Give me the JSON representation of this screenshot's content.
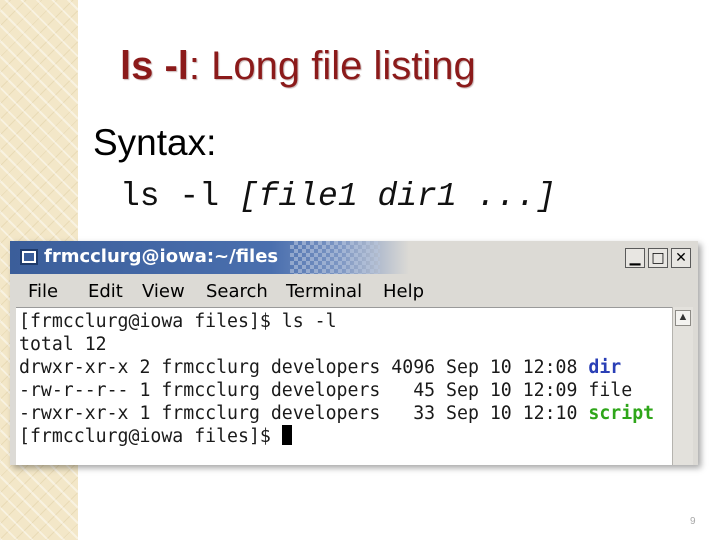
{
  "slide": {
    "title_keyword": "ls -l",
    "title_rest": ": Long file listing",
    "syntax_label": "Syntax:",
    "syntax_cmd": "ls -l ",
    "syntax_args": "[file1 dir1 ...]",
    "page_number": "9"
  },
  "terminal": {
    "window_title": "frmcclurg@iowa:~/files",
    "buttons": {
      "minimize": "▁",
      "maximize": "□",
      "close": "✕"
    },
    "menu": [
      "File",
      "Edit",
      "View",
      "Search",
      "Terminal",
      "Help"
    ],
    "lines": {
      "prompt1": "[frmcclurg@iowa files]$ ls -l",
      "total": "total 12",
      "row1_prefix": "drwxr-xr-x 2 frmcclurg developers 4096 Sep 10 12:08 ",
      "row1_name": "dir",
      "row2_prefix": "-rw-r--r-- 1 frmcclurg developers   45 Sep 10 12:09 ",
      "row2_name": "file",
      "row3_prefix": "-rwxr-xr-x 1 frmcclurg developers   33 Sep 10 12:10 ",
      "row3_name": "script",
      "prompt2": "[frmcclurg@iowa files]$ "
    },
    "colors": {
      "directory": "#2a3fb6",
      "executable": "#2fa61a",
      "title_bar": "#3b5e9a"
    }
  }
}
